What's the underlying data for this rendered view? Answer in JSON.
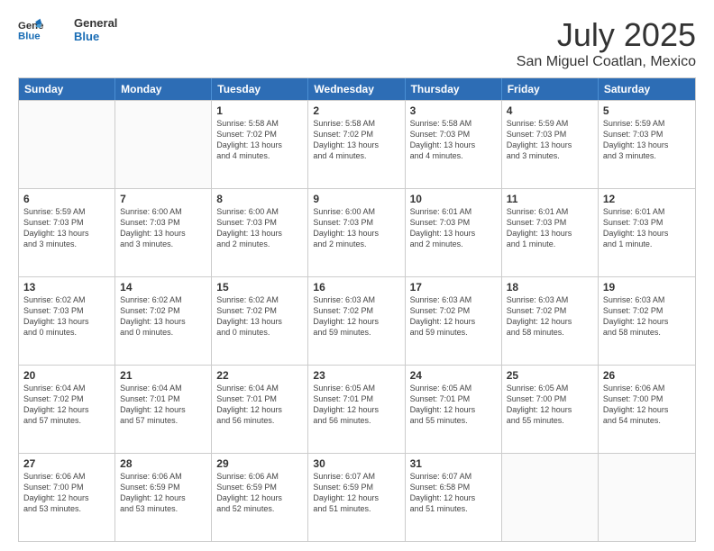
{
  "logo": {
    "line1": "General",
    "line2": "Blue"
  },
  "title": "July 2025",
  "location": "San Miguel Coatlan, Mexico",
  "weekdays": [
    "Sunday",
    "Monday",
    "Tuesday",
    "Wednesday",
    "Thursday",
    "Friday",
    "Saturday"
  ],
  "rows": [
    [
      {
        "day": "",
        "info": ""
      },
      {
        "day": "",
        "info": ""
      },
      {
        "day": "1",
        "info": "Sunrise: 5:58 AM\nSunset: 7:02 PM\nDaylight: 13 hours\nand 4 minutes."
      },
      {
        "day": "2",
        "info": "Sunrise: 5:58 AM\nSunset: 7:02 PM\nDaylight: 13 hours\nand 4 minutes."
      },
      {
        "day": "3",
        "info": "Sunrise: 5:58 AM\nSunset: 7:03 PM\nDaylight: 13 hours\nand 4 minutes."
      },
      {
        "day": "4",
        "info": "Sunrise: 5:59 AM\nSunset: 7:03 PM\nDaylight: 13 hours\nand 3 minutes."
      },
      {
        "day": "5",
        "info": "Sunrise: 5:59 AM\nSunset: 7:03 PM\nDaylight: 13 hours\nand 3 minutes."
      }
    ],
    [
      {
        "day": "6",
        "info": "Sunrise: 5:59 AM\nSunset: 7:03 PM\nDaylight: 13 hours\nand 3 minutes."
      },
      {
        "day": "7",
        "info": "Sunrise: 6:00 AM\nSunset: 7:03 PM\nDaylight: 13 hours\nand 3 minutes."
      },
      {
        "day": "8",
        "info": "Sunrise: 6:00 AM\nSunset: 7:03 PM\nDaylight: 13 hours\nand 2 minutes."
      },
      {
        "day": "9",
        "info": "Sunrise: 6:00 AM\nSunset: 7:03 PM\nDaylight: 13 hours\nand 2 minutes."
      },
      {
        "day": "10",
        "info": "Sunrise: 6:01 AM\nSunset: 7:03 PM\nDaylight: 13 hours\nand 2 minutes."
      },
      {
        "day": "11",
        "info": "Sunrise: 6:01 AM\nSunset: 7:03 PM\nDaylight: 13 hours\nand 1 minute."
      },
      {
        "day": "12",
        "info": "Sunrise: 6:01 AM\nSunset: 7:03 PM\nDaylight: 13 hours\nand 1 minute."
      }
    ],
    [
      {
        "day": "13",
        "info": "Sunrise: 6:02 AM\nSunset: 7:03 PM\nDaylight: 13 hours\nand 0 minutes."
      },
      {
        "day": "14",
        "info": "Sunrise: 6:02 AM\nSunset: 7:02 PM\nDaylight: 13 hours\nand 0 minutes."
      },
      {
        "day": "15",
        "info": "Sunrise: 6:02 AM\nSunset: 7:02 PM\nDaylight: 13 hours\nand 0 minutes."
      },
      {
        "day": "16",
        "info": "Sunrise: 6:03 AM\nSunset: 7:02 PM\nDaylight: 12 hours\nand 59 minutes."
      },
      {
        "day": "17",
        "info": "Sunrise: 6:03 AM\nSunset: 7:02 PM\nDaylight: 12 hours\nand 59 minutes."
      },
      {
        "day": "18",
        "info": "Sunrise: 6:03 AM\nSunset: 7:02 PM\nDaylight: 12 hours\nand 58 minutes."
      },
      {
        "day": "19",
        "info": "Sunrise: 6:03 AM\nSunset: 7:02 PM\nDaylight: 12 hours\nand 58 minutes."
      }
    ],
    [
      {
        "day": "20",
        "info": "Sunrise: 6:04 AM\nSunset: 7:02 PM\nDaylight: 12 hours\nand 57 minutes."
      },
      {
        "day": "21",
        "info": "Sunrise: 6:04 AM\nSunset: 7:01 PM\nDaylight: 12 hours\nand 57 minutes."
      },
      {
        "day": "22",
        "info": "Sunrise: 6:04 AM\nSunset: 7:01 PM\nDaylight: 12 hours\nand 56 minutes."
      },
      {
        "day": "23",
        "info": "Sunrise: 6:05 AM\nSunset: 7:01 PM\nDaylight: 12 hours\nand 56 minutes."
      },
      {
        "day": "24",
        "info": "Sunrise: 6:05 AM\nSunset: 7:01 PM\nDaylight: 12 hours\nand 55 minutes."
      },
      {
        "day": "25",
        "info": "Sunrise: 6:05 AM\nSunset: 7:00 PM\nDaylight: 12 hours\nand 55 minutes."
      },
      {
        "day": "26",
        "info": "Sunrise: 6:06 AM\nSunset: 7:00 PM\nDaylight: 12 hours\nand 54 minutes."
      }
    ],
    [
      {
        "day": "27",
        "info": "Sunrise: 6:06 AM\nSunset: 7:00 PM\nDaylight: 12 hours\nand 53 minutes."
      },
      {
        "day": "28",
        "info": "Sunrise: 6:06 AM\nSunset: 6:59 PM\nDaylight: 12 hours\nand 53 minutes."
      },
      {
        "day": "29",
        "info": "Sunrise: 6:06 AM\nSunset: 6:59 PM\nDaylight: 12 hours\nand 52 minutes."
      },
      {
        "day": "30",
        "info": "Sunrise: 6:07 AM\nSunset: 6:59 PM\nDaylight: 12 hours\nand 51 minutes."
      },
      {
        "day": "31",
        "info": "Sunrise: 6:07 AM\nSunset: 6:58 PM\nDaylight: 12 hours\nand 51 minutes."
      },
      {
        "day": "",
        "info": ""
      },
      {
        "day": "",
        "info": ""
      }
    ]
  ]
}
